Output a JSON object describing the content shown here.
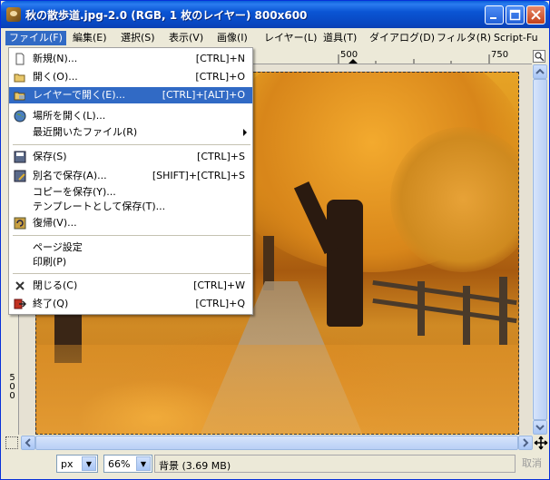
{
  "window": {
    "title": "秋の散歩道.jpg-2.0 (RGB, 1 枚のレイヤー) 800x600"
  },
  "menubar": {
    "items": [
      {
        "label": "ファイル(F)"
      },
      {
        "label": "編集(E)"
      },
      {
        "label": "選択(S)"
      },
      {
        "label": "表示(V)"
      },
      {
        "label": "画像(I)"
      },
      {
        "label": "レイヤー(L)"
      },
      {
        "label": "道具(T)"
      },
      {
        "label": "ダイアログ(D)"
      },
      {
        "label": "フィルタ(R)"
      },
      {
        "label": "Script-Fu"
      }
    ]
  },
  "file_menu": {
    "items": [
      {
        "label": "新規(N)...",
        "shortcut": "[CTRL]+N",
        "icon": "new-document-icon"
      },
      {
        "label": "開く(O)...",
        "shortcut": "[CTRL]+O",
        "icon": "open-folder-icon"
      },
      {
        "label": "レイヤーで開く(E)...",
        "shortcut": "[CTRL]+[ALT]+O",
        "icon": "open-as-layer-icon",
        "highlighted": true
      },
      {
        "label": "場所を開く(L)...",
        "shortcut": "",
        "icon": "globe-icon"
      },
      {
        "label": "最近開いたファイル(R)",
        "shortcut": "",
        "icon": "",
        "submenu": true
      },
      {
        "label": "保存(S)",
        "shortcut": "[CTRL]+S",
        "icon": "save-icon"
      },
      {
        "label": "別名で保存(A)...",
        "shortcut": "[SHIFT]+[CTRL]+S",
        "icon": "save-as-icon"
      },
      {
        "label": "コピーを保存(Y)...",
        "shortcut": "",
        "icon": ""
      },
      {
        "label": "テンプレートとして保存(T)...",
        "shortcut": "",
        "icon": ""
      },
      {
        "label": "復帰(V)...",
        "shortcut": "",
        "icon": "revert-icon"
      },
      {
        "label": "ページ設定",
        "shortcut": "",
        "icon": ""
      },
      {
        "label": "印刷(P)",
        "shortcut": "",
        "icon": ""
      },
      {
        "label": "閉じる(C)",
        "shortcut": "[CTRL]+W",
        "icon": "close-icon"
      },
      {
        "label": "終了(Q)",
        "shortcut": "[CTRL]+Q",
        "icon": "quit-icon"
      }
    ]
  },
  "rulers": {
    "top_labels": [
      "500",
      "750"
    ],
    "left_label": "500"
  },
  "statusbar": {
    "unit": "px",
    "zoom": "66%",
    "layer_info": "背景 (3.69 MB)",
    "cancel_label": "取消"
  },
  "colors": {
    "title_bar": "#0a55d4",
    "menu_highlight": "#316ac5",
    "autumn_orange": "#d98c17"
  }
}
